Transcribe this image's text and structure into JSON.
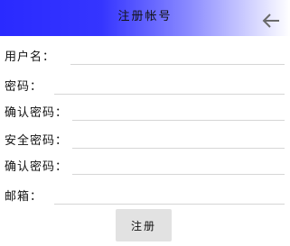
{
  "header": {
    "title": "注册帐号",
    "back_icon": "arrow-left-icon"
  },
  "form": {
    "fields": [
      {
        "label": "用户名：",
        "value": ""
      },
      {
        "label": "密码：",
        "value": ""
      },
      {
        "label": "确认密码：",
        "value": ""
      },
      {
        "label": "安全密码：",
        "value": ""
      },
      {
        "label": "确认密码：",
        "value": ""
      },
      {
        "label": "邮箱：",
        "value": ""
      }
    ],
    "submit_label": "注册"
  }
}
